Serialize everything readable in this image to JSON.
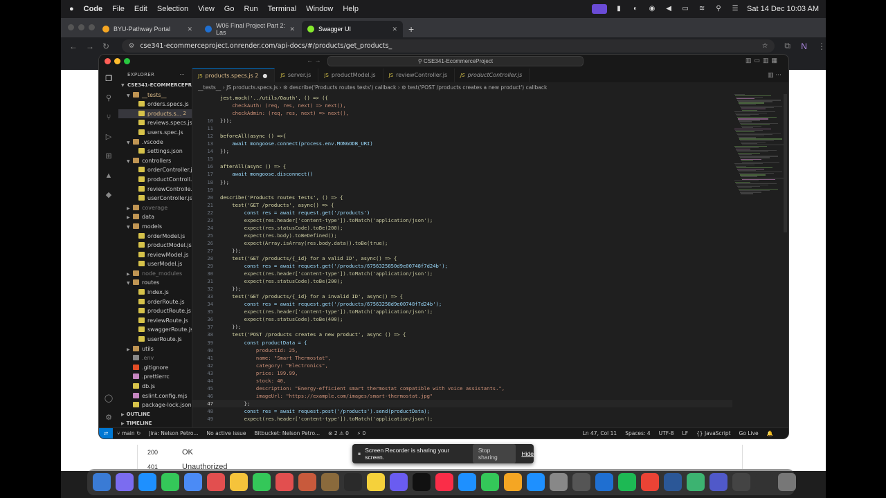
{
  "menubar": {
    "apple": "",
    "app": "Code",
    "items": [
      "File",
      "Edit",
      "Selection",
      "View",
      "Go",
      "Run",
      "Terminal",
      "Window",
      "Help"
    ],
    "clock": "Sat 14 Dec  10:03 AM"
  },
  "browser": {
    "tabs": [
      {
        "title": "BYU-Pathway Portal",
        "color": "#f5a623"
      },
      {
        "title": "W06 Final Project Part 2: Las",
        "color": "#1f6fd1"
      },
      {
        "title": "Swagger UI",
        "color": "#85ea2d"
      }
    ],
    "url": "cse341-ecommerceproject.onrender.com/api-docs/#/products/get_products_"
  },
  "swagger": {
    "rows": [
      {
        "code": "200",
        "desc": "OK"
      },
      {
        "code": "401",
        "desc": "Unauthorized"
      }
    ]
  },
  "vscode": {
    "command_center": "CSE341-EcommerceProject",
    "explorer_title": "EXPLORER",
    "project": "CSE341-ECOMMERCEPR...",
    "tree": [
      {
        "label": "__tests__",
        "depth": 1,
        "kind": "folder-open",
        "cls": "modified"
      },
      {
        "label": "orders.specs.js",
        "depth": 2,
        "kind": "js"
      },
      {
        "label": "products.s...",
        "depth": 2,
        "kind": "js",
        "selected": true,
        "badge": "2",
        "cls": "modified"
      },
      {
        "label": "reviews.specs.js",
        "depth": 2,
        "kind": "js"
      },
      {
        "label": "users.spec.js",
        "depth": 2,
        "kind": "js"
      },
      {
        "label": ".vscode",
        "depth": 1,
        "kind": "folder-open"
      },
      {
        "label": "settings.json",
        "depth": 2,
        "kind": "json"
      },
      {
        "label": "controllers",
        "depth": 1,
        "kind": "folder-open"
      },
      {
        "label": "orderController.js",
        "depth": 2,
        "kind": "js"
      },
      {
        "label": "productControll...",
        "depth": 2,
        "kind": "js"
      },
      {
        "label": "reviewControlle...",
        "depth": 2,
        "kind": "js"
      },
      {
        "label": "userController.js",
        "depth": 2,
        "kind": "js"
      },
      {
        "label": "coverage",
        "depth": 1,
        "kind": "folder",
        "dim": true
      },
      {
        "label": "data",
        "depth": 1,
        "kind": "folder"
      },
      {
        "label": "models",
        "depth": 1,
        "kind": "folder-open"
      },
      {
        "label": "orderModel.js",
        "depth": 2,
        "kind": "js"
      },
      {
        "label": "productModel.js",
        "depth": 2,
        "kind": "js"
      },
      {
        "label": "reviewModel.js",
        "depth": 2,
        "kind": "js"
      },
      {
        "label": "userModel.js",
        "depth": 2,
        "kind": "js"
      },
      {
        "label": "node_modules",
        "depth": 1,
        "kind": "folder",
        "dim": true
      },
      {
        "label": "routes",
        "depth": 1,
        "kind": "folder-open"
      },
      {
        "label": "index.js",
        "depth": 2,
        "kind": "js"
      },
      {
        "label": "orderRoute.js",
        "depth": 2,
        "kind": "js"
      },
      {
        "label": "productRoute.js",
        "depth": 2,
        "kind": "js"
      },
      {
        "label": "reviewRoute.js",
        "depth": 2,
        "kind": "js"
      },
      {
        "label": "swaggerRoute.js",
        "depth": 2,
        "kind": "js"
      },
      {
        "label": "userRoute.js",
        "depth": 2,
        "kind": "js"
      },
      {
        "label": "utils",
        "depth": 1,
        "kind": "folder"
      },
      {
        "label": ".env",
        "depth": 1,
        "kind": "env",
        "dim": true
      },
      {
        "label": ".gitignore",
        "depth": 1,
        "kind": "git"
      },
      {
        "label": ".prettierrc",
        "depth": 1,
        "kind": "cfg"
      },
      {
        "label": "db.js",
        "depth": 1,
        "kind": "js"
      },
      {
        "label": "eslint.config.mjs",
        "depth": 1,
        "kind": "cfg"
      },
      {
        "label": "package-lock.json",
        "depth": 1,
        "kind": "json"
      }
    ],
    "outline": "OUTLINE",
    "timeline": "TIMELINE",
    "editor_tabs": [
      {
        "label": "products.specs.js",
        "suffix": "2",
        "active": true
      },
      {
        "label": "server.js"
      },
      {
        "label": "productModel.js"
      },
      {
        "label": "reviewController.js"
      },
      {
        "label": "productController.js"
      }
    ],
    "breadcrumb": "__tests__  ›  JS products.specs.js  ›  ⚙ describe('Products routes tests') callback  ›  ⚙ test('POST /products creates a new product') callback",
    "code_lines": [
      {
        "n": "",
        "html": "jest.mock('../utils/Oauth', () => ({"
      },
      {
        "n": "",
        "html": "    checkAuth: (req, res, next) => next(),"
      },
      {
        "n": "",
        "html": "    checkAdmin: (req, res, next) => next(),"
      },
      {
        "n": "10",
        "html": "}));"
      },
      {
        "n": "11",
        "html": ""
      },
      {
        "n": "12",
        "html": "beforeAll(async () =>{"
      },
      {
        "n": "13",
        "html": "    await mongoose.connect(process.env.MONGODB_URI)"
      },
      {
        "n": "14",
        "html": "});"
      },
      {
        "n": "15",
        "html": ""
      },
      {
        "n": "16",
        "html": "afterAll(async () => {"
      },
      {
        "n": "17",
        "html": "    await mongoose.disconnect()"
      },
      {
        "n": "18",
        "html": "});"
      },
      {
        "n": "19",
        "html": ""
      },
      {
        "n": "20",
        "html": "describe('Products routes tests', () => {"
      },
      {
        "n": "21",
        "html": "    test('GET /products', async() => {"
      },
      {
        "n": "22",
        "html": "        const res = await request.get('/products')"
      },
      {
        "n": "23",
        "html": "        expect(res.header['content-type']).toMatch('application/json');"
      },
      {
        "n": "24",
        "html": "        expect(res.statusCode).toBe(200);"
      },
      {
        "n": "25",
        "html": "        expect(res.body).toBeDefined();"
      },
      {
        "n": "26",
        "html": "        expect(Array.isArray(res.body.data)).toBe(true);"
      },
      {
        "n": "27",
        "html": "    });"
      },
      {
        "n": "28",
        "html": "    test('GET /products/{_id} for a valid ID', async() => {"
      },
      {
        "n": "29",
        "html": "        const res = await request.get('/products/6756325850d9e00748f7d24b');"
      },
      {
        "n": "30",
        "html": "        expect(res.header['content-type']).toMatch('application/json');"
      },
      {
        "n": "31",
        "html": "        expect(res.statusCode).toBe(200);"
      },
      {
        "n": "32",
        "html": "    });"
      },
      {
        "n": "33",
        "html": "    test('GET /products/{_id} for a invalid ID', async() => {"
      },
      {
        "n": "34",
        "html": "        const res = await request.get('/products/67563258d9e00748f7d24b');"
      },
      {
        "n": "35",
        "html": "        expect(res.header['content-type']).toMatch('application/json');"
      },
      {
        "n": "36",
        "html": "        expect(res.statusCode).toBe(400);"
      },
      {
        "n": "37",
        "html": "    });"
      },
      {
        "n": "38",
        "html": "    test('POST /products creates a new product', async () => {"
      },
      {
        "n": "39",
        "html": "        const productData = {"
      },
      {
        "n": "40",
        "html": "            productId: 25,"
      },
      {
        "n": "41",
        "html": "            name: \"Smart Thermostat\","
      },
      {
        "n": "42",
        "html": "            category: \"Electronics\","
      },
      {
        "n": "43",
        "html": "            price: 199.99,"
      },
      {
        "n": "44",
        "html": "            stock: 40,"
      },
      {
        "n": "45",
        "html": "            description: \"Energy-efficient smart thermostat compatible with voice assistants.\","
      },
      {
        "n": "46",
        "html": "            imageUrl: \"https://example.com/images/smart-thermostat.jpg\""
      },
      {
        "n": "47",
        "html": "        };",
        "current": true
      },
      {
        "n": "48",
        "html": "        const res = await request.post('/products').send(productData);"
      },
      {
        "n": "49",
        "html": "        expect(res.header['content-type']).toMatch('application/json');"
      }
    ],
    "status": {
      "branch": "main",
      "jira": "Jira: Nelson Petro...",
      "issue": "No active issue",
      "bitbucket": "Bitbucket: Nelson Petro...",
      "problems": "⊗ 2 ⚠ 0",
      "ports": "⚡ 0",
      "position": "Ln 47, Col 11",
      "spaces": "Spaces: 4",
      "encoding": "UTF-8",
      "eol": "LF",
      "language": "{} JavaScript",
      "golive": "Go Live"
    }
  },
  "share_banner": {
    "message": "Screen Recorder is sharing your screen.",
    "stop": "Stop sharing",
    "hide": "Hide"
  },
  "dock_colors": [
    "#3a7bd5",
    "#7b6cf0",
    "#1e90ff",
    "#34c759",
    "#4b8bf5",
    "#e24f4f",
    "#f5c33b",
    "#34c759",
    "#e24f4f",
    "#c85a3c",
    "#8a6a3c",
    "#2a2a2a",
    "#f5d13b",
    "#6a5cf0",
    "#111111",
    "#fa2d48",
    "#1e90ff",
    "#34c759",
    "#f5a623",
    "#1e90ff",
    "#888888",
    "#555555",
    "#1f6fd1",
    "#1db954",
    "#ea4335",
    "#2b5797",
    "#3cb371",
    "#5059c9",
    "#444444",
    "#333333",
    "#777777"
  ]
}
